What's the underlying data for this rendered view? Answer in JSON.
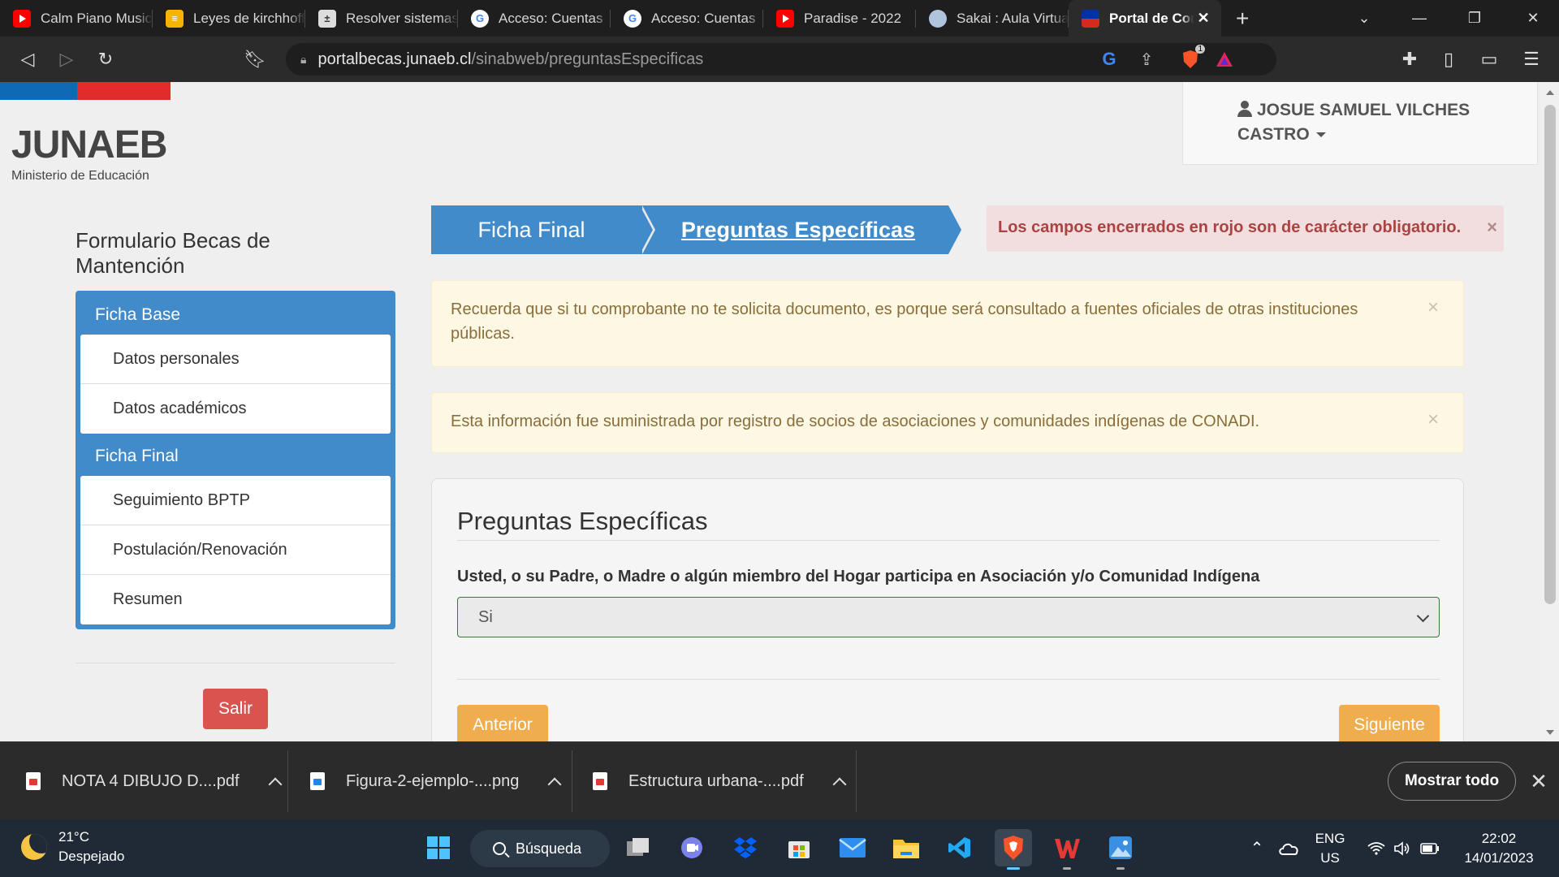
{
  "browser": {
    "tabs": [
      {
        "title": "Calm Piano Music",
        "icon": "youtube-icon"
      },
      {
        "title": "Leyes de kirchhoff",
        "icon": "document-icon"
      },
      {
        "title": "Resolver sistemas",
        "icon": "calculator-icon"
      },
      {
        "title": "Acceso: Cuentas",
        "icon": "google-icon"
      },
      {
        "title": "Acceso: Cuentas",
        "icon": "google-icon"
      },
      {
        "title": "Paradise - 2022",
        "icon": "youtube-icon"
      },
      {
        "title": "Sakai : Aula Virtual",
        "icon": "sakai-icon"
      },
      {
        "title": "Portal de Con",
        "icon": "chile-flag-icon",
        "active": true
      }
    ],
    "new_tab_label": "+",
    "address": {
      "domain": "portalbecas.junaeb.cl",
      "path": "/sinabweb/preguntasEspecificas"
    },
    "brave_badge": "1"
  },
  "page": {
    "logo": {
      "main": "JUNAEB",
      "sub": "Ministerio de Educación"
    },
    "user": {
      "name_line1": "JOSUE SAMUEL VILCHES",
      "name_line2": "CASTRO"
    },
    "form_title": "Formulario Becas de Mantención",
    "sidebar": {
      "section1": "Ficha Base",
      "section1_items": [
        "Datos personales",
        "Datos académicos"
      ],
      "section2": "Ficha Final",
      "section2_items": [
        "Seguimiento BPTP",
        "Postulación/Renovación",
        "Resumen"
      ]
    },
    "exit_button": "Salir",
    "breadcrumb": {
      "step1": "Ficha Final",
      "step2": "Preguntas Específicas"
    },
    "alert_required": "Los campos encerrados en rojo son de carácter obligatorio.",
    "alert_info1": "Recuerda que si tu comprobante no te solicita documento, es porque será consultado a fuentes oficiales de otras instituciones públicas.",
    "alert_info2": "Esta información fue suministrada por registro de socios de asociaciones y comunidades indígenas de CONADI.",
    "close_symbol": "×",
    "panel": {
      "title": "Preguntas Específicas",
      "question": "Usted, o su Padre, o Madre o algún miembro del Hogar participa en Asociación y/o Comunidad Indígena",
      "selected_value": "Si",
      "prev_button": "Anterior",
      "next_button": "Siguiente"
    }
  },
  "downloads": {
    "items": [
      {
        "name": "NOTA 4 DIBUJO D....pdf",
        "type": "pdf"
      },
      {
        "name": "Figura-2-ejemplo-....png",
        "type": "png"
      },
      {
        "name": "Estructura urbana-....pdf",
        "type": "pdf"
      }
    ],
    "show_all": "Mostrar todo"
  },
  "taskbar": {
    "weather_temp": "21°C",
    "weather_desc": "Despejado",
    "search_label": "Búsqueda",
    "lang_line1": "ENG",
    "lang_line2": "US",
    "time": "22:02",
    "date": "14/01/2023"
  },
  "colors": {
    "primary": "#428bca",
    "danger": "#d9534f",
    "warning": "#f0ad4e",
    "alert_danger_bg": "#f2dede",
    "alert_warning_bg": "#fcf8e3"
  }
}
